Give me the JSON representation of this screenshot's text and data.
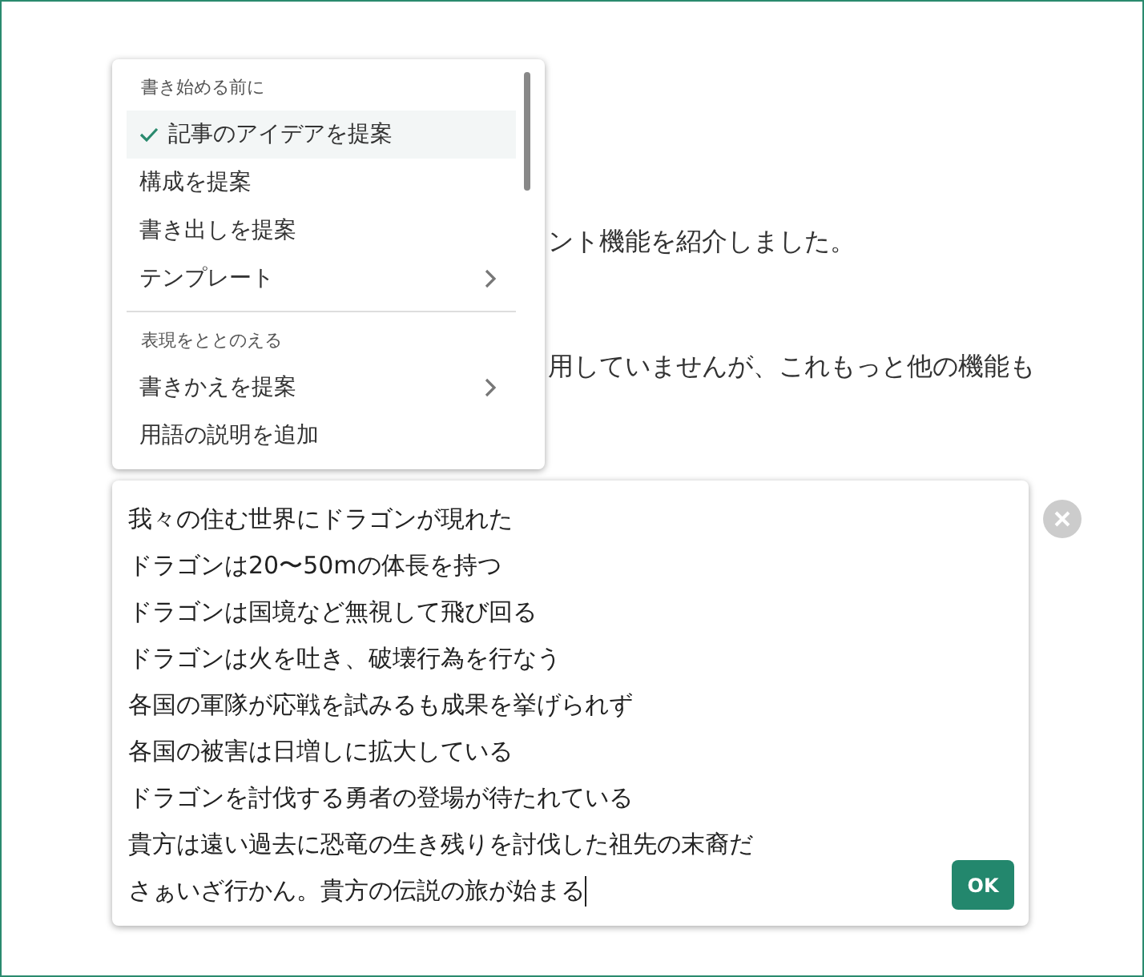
{
  "article": {
    "paragraphs": [
      "ント機能を紹介しました。",
      "用していませんが、これもっと他の機能も"
    ]
  },
  "menu": {
    "items": [
      {
        "kind": "header",
        "label": "書き始める前に"
      },
      {
        "kind": "item",
        "label": "記事のアイデアを提案",
        "selected": true,
        "submenu": false
      },
      {
        "kind": "item",
        "label": "構成を提案",
        "selected": false,
        "submenu": false
      },
      {
        "kind": "item",
        "label": "書き出しを提案",
        "selected": false,
        "submenu": false
      },
      {
        "kind": "item",
        "label": "テンプレート",
        "selected": false,
        "submenu": true
      },
      {
        "kind": "divider"
      },
      {
        "kind": "header",
        "label": "表現をととのえる"
      },
      {
        "kind": "item",
        "label": "書きかえを提案",
        "selected": false,
        "submenu": true
      },
      {
        "kind": "item",
        "label": "用語の説明を追加",
        "selected": false,
        "submenu": false
      }
    ]
  },
  "editor": {
    "lines": [
      "我々の住む世界にドラゴンが現れた",
      "ドラゴンは20〜50mの体長を持つ",
      "ドラゴンは国境など無視して飛び回る",
      "ドラゴンは火を吐き、破壊行為を行なう",
      "各国の軍隊が応戦を試みるも成果を挙げられず",
      "各国の被害は日増しに拡大している",
      "ドラゴンを討伐する勇者の登場が待たれている",
      "貴方は遠い過去に恐竜の生き残りを討伐した祖先の末裔だ",
      "さぁいざ行かん。貴方の伝説の旅が始まる"
    ],
    "ok_button": "OK"
  }
}
